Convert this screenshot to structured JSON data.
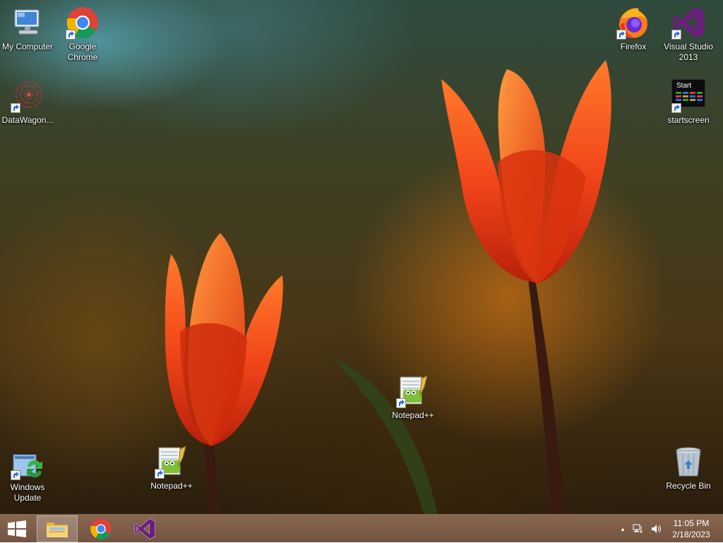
{
  "desktop": {
    "icons": [
      {
        "label": "My Computer",
        "icon": "my-computer-icon"
      },
      {
        "label": "Google Chrome",
        "icon": "chrome-icon"
      },
      {
        "label": "DataWagon...",
        "icon": "datawagon-icon"
      },
      {
        "label": "Firefox",
        "icon": "firefox-icon"
      },
      {
        "label": "Visual Studio 2013",
        "icon": "visual-studio-icon"
      },
      {
        "label": "startscreen",
        "icon": "startscreen-icon",
        "tile_text": "Start"
      },
      {
        "label": "Notepad++",
        "icon": "notepadpp-icon"
      },
      {
        "label": "Notepad++",
        "icon": "notepadpp-icon"
      },
      {
        "label": "Windows Update",
        "icon": "windows-update-icon"
      },
      {
        "label": "Recycle Bin",
        "icon": "recycle-bin-icon"
      }
    ]
  },
  "taskbar": {
    "pinned": [
      {
        "name": "File Explorer",
        "icon": "file-explorer-icon",
        "active": true
      },
      {
        "name": "Google Chrome",
        "icon": "chrome-icon",
        "active": false
      },
      {
        "name": "Visual Studio",
        "icon": "visual-studio-icon",
        "active": false
      }
    ],
    "tray": {
      "show_hidden_glyph": "▲",
      "time": "11:05 PM",
      "date": "2/18/2023"
    }
  },
  "colors": {
    "taskbar": "#7a5a45",
    "vs_purple": "#68217a",
    "chrome_red": "#db4437",
    "chrome_yellow": "#f4b400",
    "chrome_green": "#0f9d58",
    "chrome_blue": "#4285f4"
  }
}
